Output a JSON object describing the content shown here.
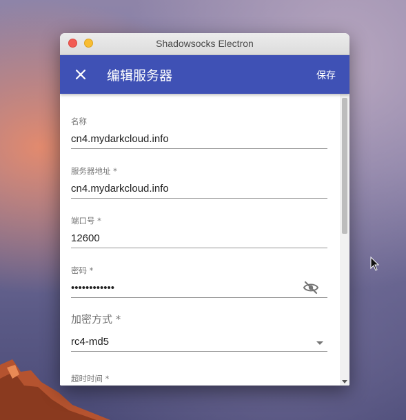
{
  "window": {
    "title": "Shadowsocks Electron"
  },
  "appbar": {
    "title": "编辑服务器",
    "save_label": "保存"
  },
  "fields": {
    "name": {
      "label": "名称",
      "value": "cn4.mydarkcloud.info"
    },
    "server": {
      "label": "服务器地址 *",
      "value": "cn4.mydarkcloud.info"
    },
    "port": {
      "label": "端口号 *",
      "value": "12600"
    },
    "password": {
      "label": "密码 *",
      "value": "••••••••••••"
    },
    "method": {
      "label": "加密方式 *",
      "value": "rc4-md5"
    },
    "timeout": {
      "label": "超时时间 *"
    }
  },
  "colors": {
    "appbar": "#3f51b5",
    "close_dot": "#f25c54",
    "minimize_dot": "#f8bd32"
  }
}
